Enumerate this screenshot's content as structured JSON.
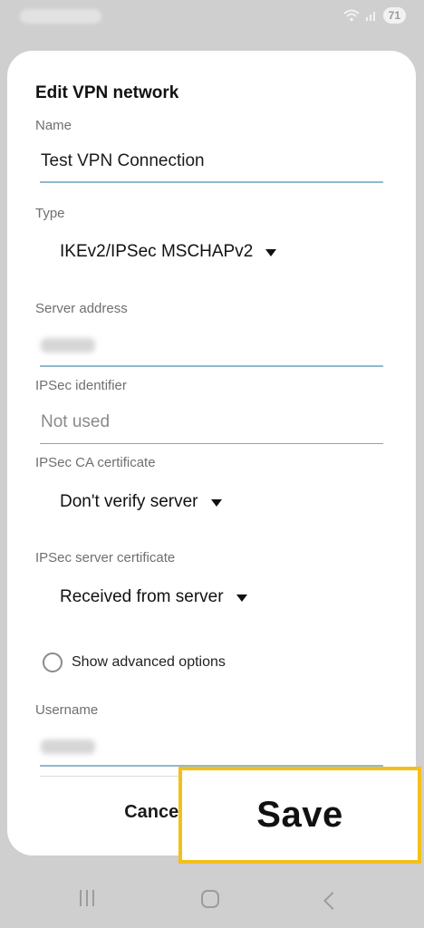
{
  "status": {
    "time_redacted": "",
    "battery": "71"
  },
  "dialog": {
    "title": "Edit VPN network",
    "fields": {
      "name": {
        "label": "Name",
        "value": "Test VPN Connection"
      },
      "type": {
        "label": "Type",
        "value": "IKEv2/IPSec MSCHAPv2"
      },
      "server_address": {
        "label": "Server address"
      },
      "ipsec_identifier": {
        "label": "IPSec identifier",
        "placeholder": "Not used"
      },
      "ipsec_ca_certificate": {
        "label": "IPSec CA certificate",
        "value": "Don't verify server"
      },
      "ipsec_server_certificate": {
        "label": "IPSec server certificate",
        "value": "Received from server"
      },
      "show_advanced": {
        "label": "Show advanced options",
        "checked": false
      },
      "username": {
        "label": "Username"
      }
    },
    "buttons": {
      "cancel": "Cancel",
      "save": "Save"
    }
  },
  "colors": {
    "highlight": "#f3c019",
    "active_underline": "#8fb9cf"
  },
  "icons": {
    "wifi": "wifi-icon",
    "signal": "signal-icon",
    "recents": "recents-icon",
    "home": "home-icon",
    "back": "back-icon"
  }
}
